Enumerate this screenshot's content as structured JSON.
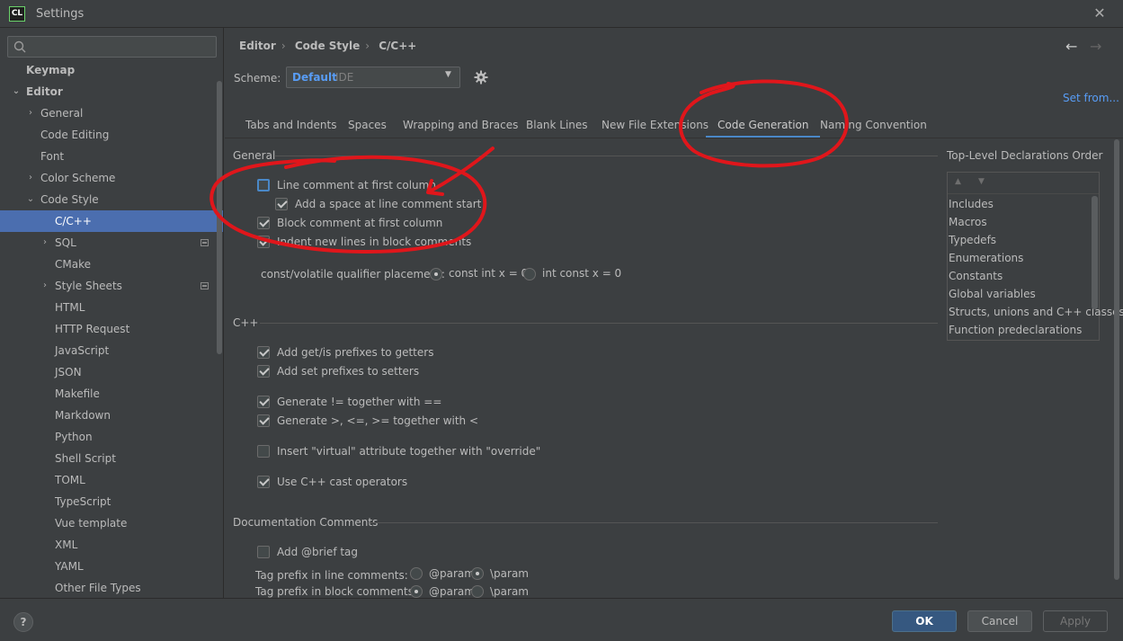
{
  "window": {
    "title": "Settings",
    "logo": "CL"
  },
  "search": {
    "placeholder": ""
  },
  "sidebar": {
    "items": [
      {
        "label": "Keymap"
      },
      {
        "label": "Editor"
      },
      {
        "label": "General"
      },
      {
        "label": "Code Editing"
      },
      {
        "label": "Font"
      },
      {
        "label": "Color Scheme"
      },
      {
        "label": "Code Style"
      },
      {
        "label": "C/C++"
      },
      {
        "label": "SQL"
      },
      {
        "label": "CMake"
      },
      {
        "label": "Style Sheets"
      },
      {
        "label": "HTML"
      },
      {
        "label": "HTTP Request"
      },
      {
        "label": "JavaScript"
      },
      {
        "label": "JSON"
      },
      {
        "label": "Makefile"
      },
      {
        "label": "Markdown"
      },
      {
        "label": "Python"
      },
      {
        "label": "Shell Script"
      },
      {
        "label": "TOML"
      },
      {
        "label": "TypeScript"
      },
      {
        "label": "Vue template"
      },
      {
        "label": "XML"
      },
      {
        "label": "YAML"
      },
      {
        "label": "Other File Types"
      }
    ]
  },
  "breadcrumb": [
    "Editor",
    "Code Style",
    "C/C++"
  ],
  "scheme": {
    "label": "Scheme:",
    "name": "Default",
    "kind": "IDE",
    "set_from": "Set from..."
  },
  "tabs": [
    "Tabs and Indents",
    "Spaces",
    "Wrapping and Braces",
    "Blank Lines",
    "New File Extensions",
    "Code Generation",
    "Naming Convention"
  ],
  "general": {
    "title": "General",
    "line_comment": "Line comment at first column",
    "add_space": "Add a space at line comment start",
    "block_comment": "Block comment at first column",
    "indent_block": "Indent new lines in block comments",
    "cv_label": "const/volatile qualifier placement:",
    "cv_opt1": "const int x = 0",
    "cv_opt2": "int const x = 0"
  },
  "cpp": {
    "title": "C++",
    "getters": "Add get/is prefixes to getters",
    "setters": "Add set prefixes to setters",
    "neq": "Generate != together with ==",
    "cmp": "Generate >, <=, >= together with <",
    "virtual": "Insert \"virtual\" attribute together with \"override\"",
    "cast": "Use C++ cast operators"
  },
  "doc": {
    "title": "Documentation Comments",
    "brief": "Add @brief tag",
    "line_prefix": "Tag prefix in line comments:",
    "block_prefix": "Tag prefix in block comments:",
    "at_param": "@param",
    "bs_param": "\\param"
  },
  "toplevel": {
    "title": "Top-Level Declarations Order",
    "items": [
      "Includes",
      "Macros",
      "Typedefs",
      "Enumerations",
      "Constants",
      "Global variables",
      "Structs, unions and C++ classes",
      "Function predeclarations"
    ]
  },
  "footer": {
    "help": "?",
    "ok": "OK",
    "cancel": "Cancel",
    "apply": "Apply"
  },
  "colors": {
    "accent": "#4a88c7",
    "selection": "#4b6eaf",
    "link": "#589df6",
    "annotation": "#e0161b"
  }
}
